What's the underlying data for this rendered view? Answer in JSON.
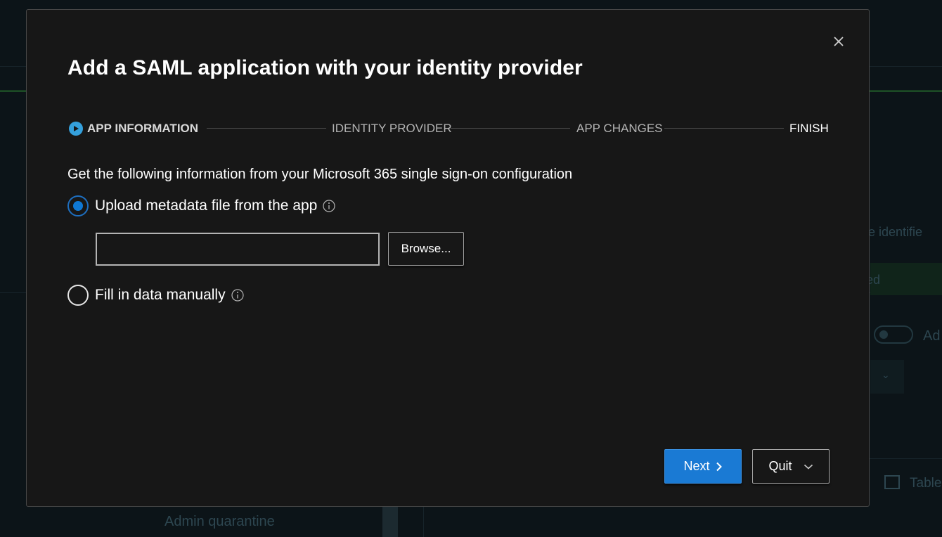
{
  "colors": {
    "accent": "#1a7ad4",
    "active_step": "#34a0dc",
    "modal_bg": "#171717",
    "highlight_line": "#3fbf3f"
  },
  "background": {
    "right_text_1": "ce identifie",
    "right_text_2": "ed",
    "right_toggle_text": "Ad",
    "right_table_label": "Table",
    "sidebar_item": "Admin quarantine"
  },
  "dialog": {
    "title": "Add a SAML application with your identity provider",
    "close_icon": "close-icon",
    "steps": [
      {
        "label": "APP INFORMATION",
        "state": "active"
      },
      {
        "label": "IDENTITY PROVIDER",
        "state": "upcoming"
      },
      {
        "label": "APP CHANGES",
        "state": "upcoming"
      },
      {
        "label": "FINISH",
        "state": "upcoming"
      }
    ],
    "instruction": "Get the following information from your Microsoft 365 single sign-on configuration",
    "options": [
      {
        "label": "Upload metadata file from the app",
        "selected": true
      },
      {
        "label": "Fill in data manually",
        "selected": false
      }
    ],
    "file_input": {
      "value": "",
      "placeholder": ""
    },
    "browse_label": "Browse...",
    "next_label": "Next",
    "quit_label": "Quit"
  }
}
